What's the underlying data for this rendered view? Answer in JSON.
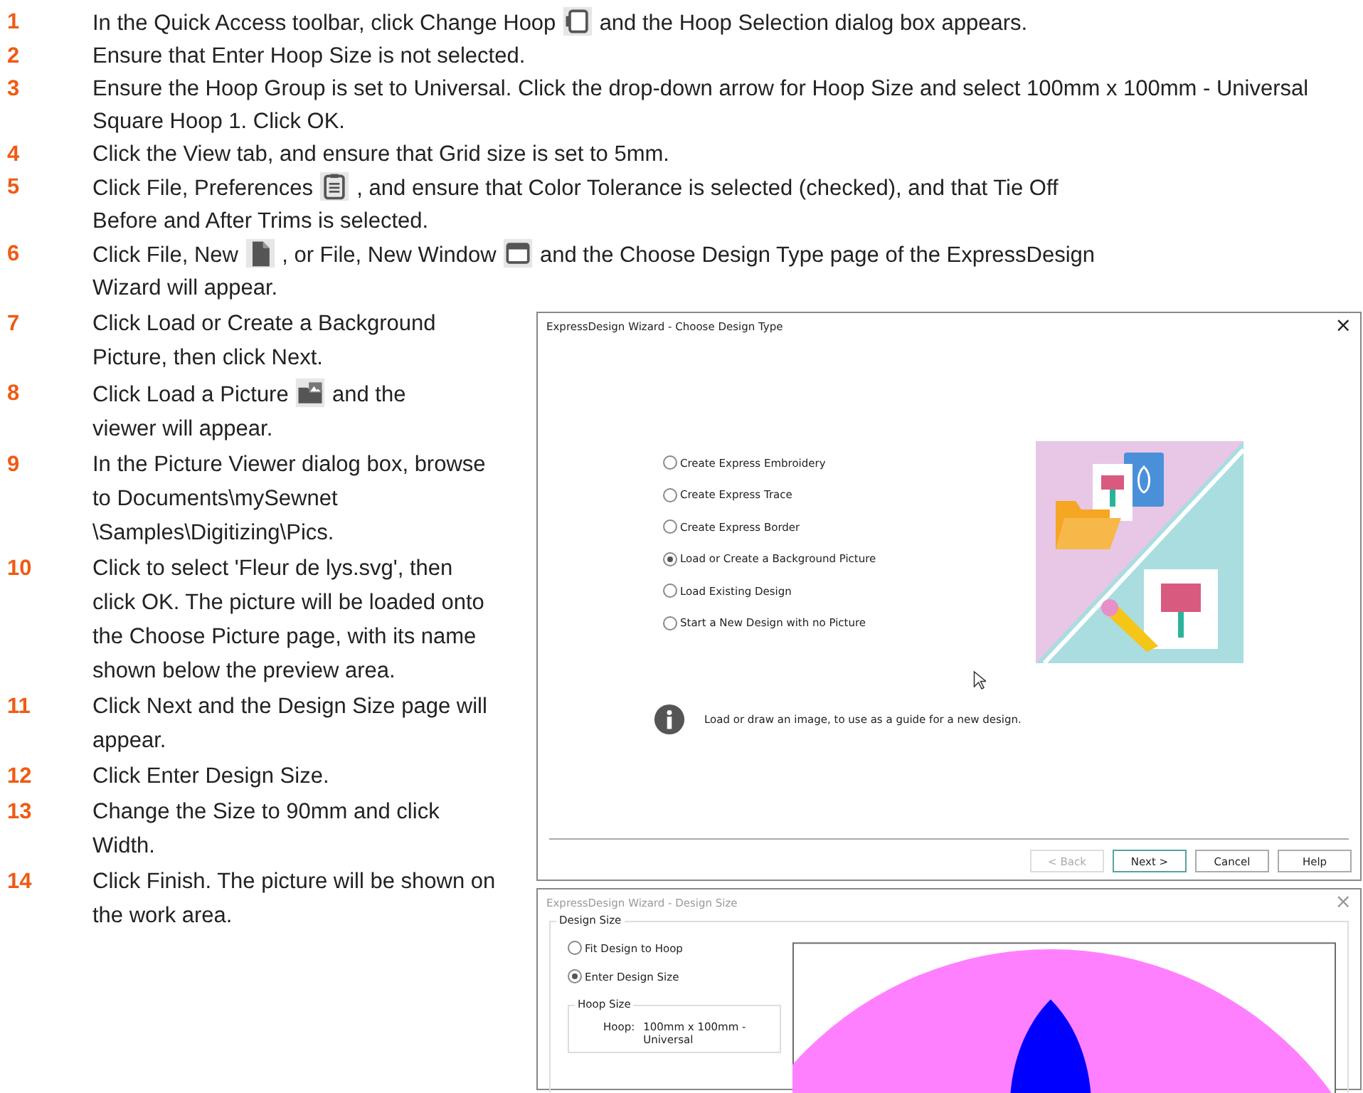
{
  "steps_full": [
    {
      "number": "1",
      "parts": [
        {
          "kind": "text",
          "text": "In the Quick Access toolbar, click Change Hoop"
        },
        {
          "kind": "hoop"
        },
        {
          "kind": "text",
          "text": "and the Hoop Selection dialog box appears."
        }
      ]
    },
    {
      "number": "2",
      "parts": [
        {
          "kind": "text",
          "text": "Ensure that Enter Hoop Size is not selected."
        }
      ]
    },
    {
      "number": "3",
      "parts": [
        {
          "kind": "text",
          "text": "Ensure the Hoop Group is set to Universal. Click the drop-down arrow for Hoop Size and select 100mm x 100mm - Universal Square Hoop 1. Click OK."
        }
      ]
    },
    {
      "number": "4",
      "parts": [
        {
          "kind": "text",
          "text": "Click the View tab, and ensure that Grid size is set to 5mm."
        }
      ]
    },
    {
      "number": "5",
      "parts": [
        {
          "kind": "text",
          "text": "Click File, Preferences"
        },
        {
          "kind": "preferences"
        },
        {
          "kind": "text",
          "text": ", and ensure that Color Tolerance is selected (checked), and that Tie Off"
        },
        {
          "kind": "break"
        },
        {
          "kind": "text",
          "text": "Before and After Trims is selected."
        }
      ]
    },
    {
      "number": "6",
      "parts": [
        {
          "kind": "text",
          "text": "Click File, New"
        },
        {
          "kind": "new"
        },
        {
          "kind": "text",
          "text": ", or File, New Window"
        },
        {
          "kind": "window"
        },
        {
          "kind": "text",
          "text": "and the Choose Design Type page of the ExpressDesign"
        },
        {
          "kind": "break"
        },
        {
          "kind": "text",
          "text": "Wizard will appear."
        }
      ]
    }
  ],
  "steps_side": [
    {
      "number": "7",
      "parts": [
        {
          "kind": "text",
          "text": "Click Load or Create a Background Picture, then click Next."
        }
      ]
    },
    {
      "number": "8",
      "parts": [
        {
          "kind": "text",
          "text": "Click Load a Picture"
        },
        {
          "kind": "picture"
        },
        {
          "kind": "text",
          "text": "and the"
        },
        {
          "kind": "break"
        },
        {
          "kind": "text",
          "text": "viewer will appear."
        }
      ]
    },
    {
      "number": "9",
      "parts": [
        {
          "kind": "text",
          "text": "In the Picture Viewer dialog box, browse to Documents\\mySewnet \\Samples\\Digitizing\\Pics."
        }
      ]
    },
    {
      "number": "10",
      "parts": [
        {
          "kind": "text",
          "text": "Click to select 'Fleur de lys.svg', then click OK. The picture will be loaded onto the Choose Picture page, with its name shown below the preview area."
        }
      ]
    },
    {
      "number": "11",
      "parts": [
        {
          "kind": "text",
          "text": "Click Next and the Design Size page will appear."
        }
      ]
    },
    {
      "number": "12",
      "parts": [
        {
          "kind": "text",
          "text": "Click Enter Design Size."
        }
      ]
    },
    {
      "number": "13",
      "parts": [
        {
          "kind": "text",
          "text": "Change the Size to 90mm and click Width."
        }
      ]
    },
    {
      "number": "14",
      "parts": [
        {
          "kind": "text",
          "text": "Click Finish. The picture will be shown on the work area."
        }
      ]
    }
  ],
  "dialog_type": {
    "title": "ExpressDesign Wizard - Choose Design Type",
    "close": "×",
    "options": [
      {
        "label": "Create Express Embroidery",
        "selected": false
      },
      {
        "label": "Create Express Trace",
        "selected": false
      },
      {
        "label": "Create Express Border",
        "selected": false
      },
      {
        "label": "Load or Create a Background Picture",
        "selected": true
      },
      {
        "label": "Load Existing Design",
        "selected": false
      },
      {
        "label": "Start a New Design with no Picture",
        "selected": false
      }
    ],
    "info": "Load or draw an image, to use as a guide for a new design.",
    "buttons": [
      {
        "label": "< Back",
        "disabled": true
      },
      {
        "label": "Next >",
        "disabled": false
      },
      {
        "label": "Cancel",
        "disabled": false
      },
      {
        "label": "Help",
        "disabled": false
      }
    ]
  },
  "dialog_size": {
    "title": "ExpressDesign Wizard - Design Size",
    "close": "×",
    "group": "Design Size",
    "options": [
      {
        "label": "Fit Design to Hoop",
        "selected": false
      },
      {
        "label": "Enter Design Size",
        "selected": true
      }
    ],
    "hoop_group": "Hoop Size",
    "hoop_label": "Hoop:",
    "hoop_value": "100mm x 100mm - Universal"
  }
}
